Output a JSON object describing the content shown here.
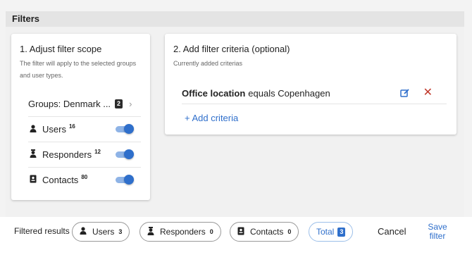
{
  "header": {
    "title": "Filters"
  },
  "scope": {
    "title": "1. Adjust filter scope",
    "description": "The filter will apply to the selected groups and user types.",
    "groups": {
      "label": "Groups: Denmark ...",
      "count": "2"
    },
    "types": [
      {
        "label": "Users",
        "count": "16",
        "icon": "person-icon",
        "enabled": true
      },
      {
        "label": "Responders",
        "count": "12",
        "icon": "responder-icon",
        "enabled": true
      },
      {
        "label": "Contacts",
        "count": "80",
        "icon": "contact-card-icon",
        "enabled": true
      }
    ]
  },
  "criteria": {
    "title": "2. Add filter criteria (optional)",
    "subtitle": "Currently added criterias",
    "items": [
      {
        "field": "Office location",
        "rest": "equals Copenhagen"
      }
    ],
    "add_label": "+ Add criteria"
  },
  "footer": {
    "label": "Filtered results",
    "chips": [
      {
        "label": "Users",
        "count": "3"
      },
      {
        "label": "Responders",
        "count": "0"
      },
      {
        "label": "Contacts",
        "count": "0"
      }
    ],
    "total": {
      "label": "Total",
      "count": "3"
    },
    "cancel_label": "Cancel",
    "save_label": "Save filter"
  },
  "colors": {
    "accent": "#2f6fcb",
    "toggle_track": "#8eb3e6",
    "delete": "#c0392b",
    "badge_dark": "#2b2b2b"
  }
}
